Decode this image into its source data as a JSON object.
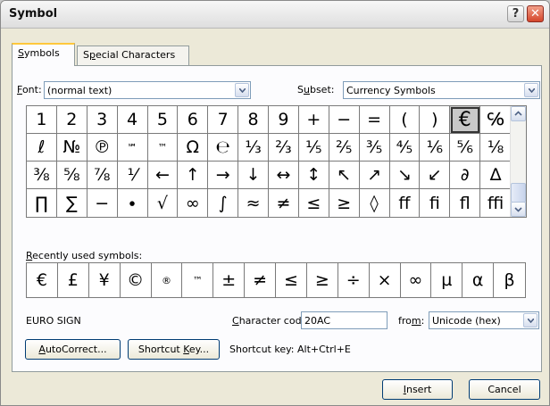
{
  "window": {
    "title": "Symbol"
  },
  "tabs": [
    {
      "prefix": "",
      "key": "S",
      "rest": "ymbols"
    },
    {
      "prefix": "S",
      "key": "p",
      "rest": "ecial Characters"
    }
  ],
  "font": {
    "key": "F",
    "rest": "ont:",
    "value": "(normal text)"
  },
  "subset": {
    "prefix": "S",
    "key": "u",
    "rest": "bset:",
    "value": "Currency Symbols"
  },
  "symbols": [
    [
      "1",
      "2",
      "3",
      "4",
      "5",
      "6",
      "7",
      "8",
      "9",
      "+",
      "−",
      "=",
      "(",
      ")",
      "€",
      "℅"
    ],
    [
      "ℓ",
      "№",
      "℗",
      "℠",
      "™",
      "Ω",
      "℮",
      "⅓",
      "⅔",
      "⅕",
      "⅖",
      "⅗",
      "⅘",
      "⅙",
      "⅚",
      "⅛"
    ],
    [
      "⅜",
      "⅝",
      "⅞",
      "⅟",
      "←",
      "↑",
      "→",
      "↓",
      "↔",
      "↕",
      "↖",
      "↗",
      "↘",
      "↙",
      "∂",
      "∆"
    ],
    [
      "∏",
      "∑",
      "−",
      "∙",
      "√",
      "∞",
      "∫",
      "≈",
      "≠",
      "≤",
      "≥",
      "◊",
      "ﬀ",
      "ﬁ",
      "ﬂ",
      "ﬃ"
    ]
  ],
  "selected": {
    "row": 0,
    "col": 14
  },
  "recent": {
    "key": "R",
    "rest": "ecently used symbols:",
    "items": [
      "€",
      "£",
      "¥",
      "©",
      "®",
      "™",
      "±",
      "≠",
      "≤",
      "≥",
      "÷",
      "×",
      "∞",
      "µ",
      "α",
      "β"
    ]
  },
  "char_name": "EURO SIGN",
  "char_code": {
    "key": "C",
    "rest": "haracter code:",
    "value": "20AC"
  },
  "from": {
    "prefix": "fro",
    "key": "m",
    "rest": ":",
    "value": "Unicode (hex)"
  },
  "autocorrect": {
    "key": "A",
    "rest": "utoCorrect..."
  },
  "shortcut_key_btn": {
    "prefix": "Shortcut ",
    "key": "K",
    "rest": "ey..."
  },
  "shortcut_text": "Shortcut key: Alt+Ctrl+E",
  "insert": {
    "key": "I",
    "rest": "nsert"
  },
  "cancel": "Cancel"
}
